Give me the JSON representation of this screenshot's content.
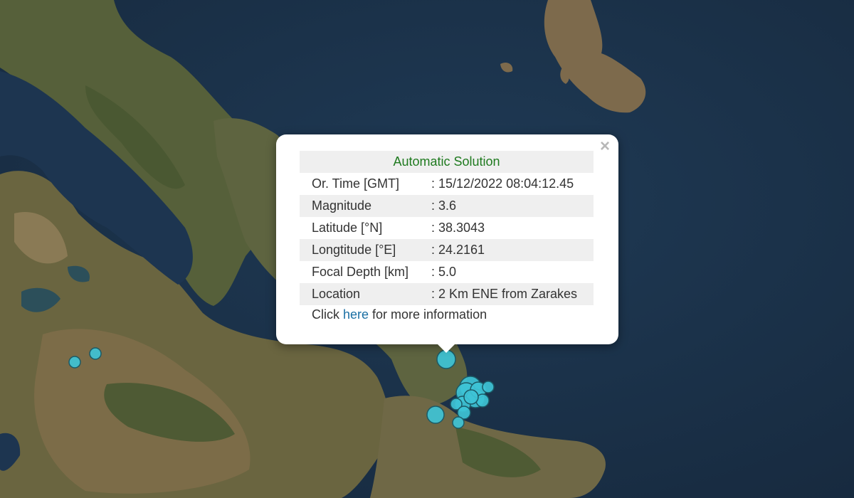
{
  "map": {
    "water_color": "#1c3148",
    "land_color": "#6b6a42",
    "marker_fill": "#3ec3d6",
    "marker_stroke": "#1b5a66"
  },
  "popup": {
    "close_glyph": "×",
    "title": "Automatic Solution",
    "rows": [
      {
        "label": "Or. Time [GMT]",
        "value": ": 15/12/2022 08:04:12.45"
      },
      {
        "label": "Magnitude",
        "value": ": 3.6"
      },
      {
        "label": "Latitude [°N]",
        "value": ": 38.3043"
      },
      {
        "label": "Longtitude [°E]",
        "value": ": 24.2161"
      },
      {
        "label": "Focal Depth [km]",
        "value": ": 5.0"
      },
      {
        "label": "Location",
        "value": ": 2 Km ENE from Zarakes"
      }
    ],
    "click_prefix": "Click ",
    "click_link": "here",
    "click_suffix": " for more information"
  }
}
